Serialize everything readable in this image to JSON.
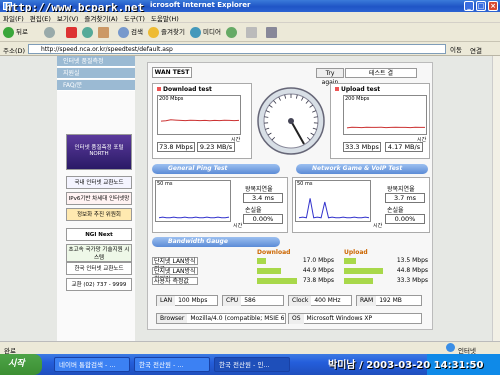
{
  "window": {
    "watermark": "http://www.bcpark.net",
    "title": "icrosoft Internet Explorer"
  },
  "menu": [
    "파일(F)",
    "편집(E)",
    "보기(V)",
    "즐겨찾기(A)",
    "도구(T)",
    "도움말(H)"
  ],
  "toolbar": {
    "back": "뒤로",
    "search": "검색",
    "favorites": "즐겨찾기",
    "media": "미디어"
  },
  "address": {
    "label": "주소(D)",
    "url": "http://speed.nca.or.kr/speedtest/default.asp",
    "go": "이동",
    "links": "연결"
  },
  "sidebar": {
    "nav": [
      "인터넷 품질측정",
      "지원실",
      "FAQ/문"
    ],
    "banners": [
      "인터넷 품질측정 포털 NORTH",
      "국내 인터넷 교환노드",
      "IPv6기반 차세대 인터넷망",
      "정보화 추진 위원회",
      "NGI Next Generation",
      "초고속 국가망 기술지원 시스템",
      "한국 인터넷 교환노드",
      "교환 (02) 737 - 9999"
    ]
  },
  "speedtest": {
    "tab": "WAN TEST",
    "try_again": "Try again",
    "test_result": "테스트 결",
    "download": {
      "title": "Download test",
      "ymax": "200 Mbps",
      "axis": "시간",
      "throughput": "73.8 Mbps",
      "rate": "9.23 MB/s"
    },
    "upload": {
      "title": "Upload test",
      "ymax": "200 Mbps",
      "axis": "시간",
      "throughput": "33.3 Mbps",
      "rate": "4.17 MB/s"
    },
    "ping": {
      "general_title": "General Ping Test",
      "general_ymax": "50 ms",
      "general_rtt_label": "왕복지연율",
      "general_rtt": "3.4 ms",
      "general_loss_label": "손실율",
      "general_loss": "0.00%",
      "voip_title": "Network Game & VoIP Test",
      "voip_ymax": "50 ms",
      "voip_rtt_label": "왕복지연율",
      "voip_rtt": "3.7 ms",
      "voip_loss_label": "손실율",
      "voip_loss": "0.00%",
      "axis": "시간"
    },
    "bandwidth": {
      "title": "Bandwidth Gauge",
      "download_header": "Download",
      "upload_header": "Upload",
      "rows": [
        {
          "label": "단지넷 LAN방식 평균",
          "download": "17.0 Mbps",
          "upload": "13.5 Mbps",
          "dl_frac": 0.23,
          "ul_frac": 0.3
        },
        {
          "label": "단지넷 LAN방식 최대값",
          "download": "44.9 Mbps",
          "upload": "44.8 Mbps",
          "dl_frac": 0.61,
          "ul_frac": 0.97
        },
        {
          "label": "사용자 측정값",
          "download": "73.8 Mbps",
          "upload": "33.3 Mbps",
          "dl_frac": 1.0,
          "ul_frac": 0.72
        }
      ]
    },
    "system": {
      "lan_label": "LAN",
      "lan": "100 Mbps",
      "cpu_label": "CPU",
      "cpu": "586",
      "clock_label": "Clock",
      "clock": "400 MHz",
      "ram_label": "RAM",
      "ram": "192 MB",
      "browser_label": "Browser",
      "browser": "Mozilla/4.0 (compatible; MSIE 6.0",
      "os_label": "OS",
      "os": "Microsoft Windows XP"
    }
  },
  "status": {
    "left": "완료",
    "zone": "인터넷"
  },
  "taskbar": {
    "start": "시작",
    "tasks": [
      "네이버 통합검색 - ...",
      "한국 전산원 - ...",
      "한국 전산원 - 인..."
    ]
  },
  "stamp": "박미남 / 2003-03-20 14:31:50",
  "chart_data": [
    {
      "type": "line",
      "title": "Download test",
      "ylim": [
        0,
        200
      ],
      "ylabel": "Mbps",
      "xlabel": "시간",
      "series": [
        {
          "values": [
            70,
            72,
            78,
            76,
            74,
            73,
            75,
            74,
            73,
            74,
            72,
            74,
            73,
            75,
            74,
            73,
            74
          ]
        }
      ]
    },
    {
      "type": "line",
      "title": "Upload test",
      "ylim": [
        0,
        200
      ],
      "ylabel": "Mbps",
      "xlabel": "시간",
      "series": [
        {
          "values": [
            30,
            34,
            33,
            32,
            34,
            33,
            33,
            34,
            32,
            33,
            34,
            33,
            33,
            32,
            34,
            33,
            33
          ]
        }
      ]
    },
    {
      "type": "line",
      "title": "General Ping Test",
      "ylim": [
        0,
        50
      ],
      "ylabel": "ms",
      "xlabel": "시간",
      "series": [
        {
          "values": [
            3,
            4,
            3,
            3,
            4,
            3,
            3,
            4,
            3,
            3,
            4,
            3,
            3,
            4,
            3,
            3,
            4,
            3,
            3,
            4
          ]
        }
      ]
    },
    {
      "type": "line",
      "title": "Network Game & VoIP Test",
      "ylim": [
        0,
        50
      ],
      "ylabel": "ms",
      "xlabel": "시간",
      "series": [
        {
          "values": [
            3,
            4,
            3,
            30,
            3,
            4,
            3,
            25,
            3,
            4,
            3,
            3,
            4,
            3,
            3,
            4,
            3,
            3,
            4,
            3
          ]
        }
      ]
    }
  ]
}
